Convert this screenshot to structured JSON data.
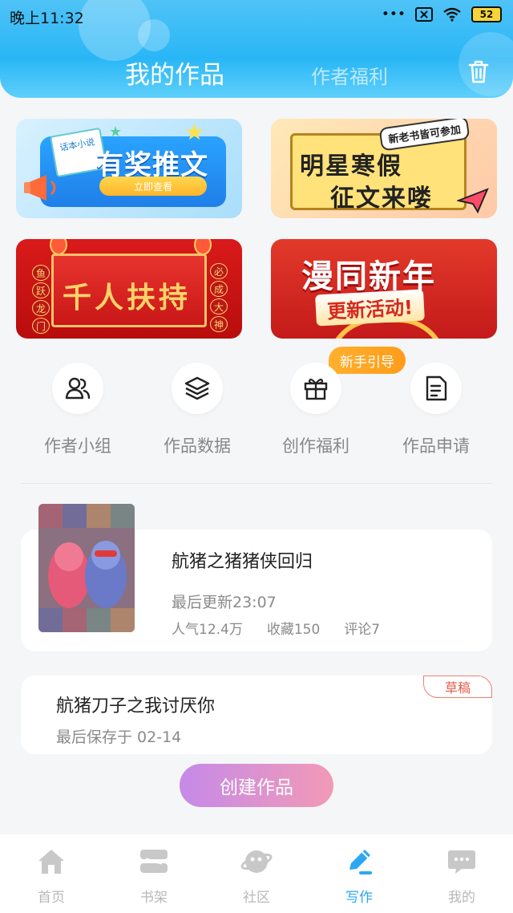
{
  "status_bar": {
    "time": "晚上11:32",
    "icons": [
      "more-dots-icon",
      "sim-off-icon",
      "wifi-icon",
      "battery-icon"
    ],
    "signal_dots": "•••",
    "battery_level": "52"
  },
  "header": {
    "tabs": [
      {
        "label": "我的作品",
        "active": true
      },
      {
        "label": "作者福利",
        "active": false
      }
    ],
    "trash_icon": "trash-icon",
    "accent": "#29b6f6"
  },
  "banners": [
    {
      "title": "有奖推文",
      "note": "话本小说",
      "button": "立即查看"
    },
    {
      "tag": "新老书皆可参加",
      "line1": "明星寒假",
      "line2": "征文来喽"
    },
    {
      "title": "千人扶持",
      "left_chars": [
        "鱼",
        "跃",
        "龙",
        "门"
      ],
      "right_chars": [
        "必",
        "成",
        "大",
        "神"
      ]
    },
    {
      "title": "漫同新年",
      "subtitle": "更新活动!"
    }
  ],
  "guide_badge": "新手引导",
  "quick_entries": [
    {
      "label": "作者小组",
      "icon": "author-group-icon"
    },
    {
      "label": "作品数据",
      "icon": "layers-icon"
    },
    {
      "label": "创作福利",
      "icon": "gift-icon"
    },
    {
      "label": "作品申请",
      "icon": "document-icon"
    }
  ],
  "works": [
    {
      "title": "航猪之猪猪侠回归",
      "updated": "最后更新23:07",
      "stats": [
        "人气12.4万",
        "收藏150",
        "评论7"
      ]
    }
  ],
  "drafts": [
    {
      "badge": "草稿",
      "title": "航猪刀子之我讨厌你",
      "saved": "最后保存于 02-14"
    }
  ],
  "create_button": "创建作品",
  "bottom_nav": [
    {
      "label": "首页",
      "icon": "home-icon",
      "active": false
    },
    {
      "label": "书架",
      "icon": "bookshelf-icon",
      "active": false
    },
    {
      "label": "社区",
      "icon": "community-icon",
      "active": false
    },
    {
      "label": "写作",
      "icon": "pen-icon",
      "active": true
    },
    {
      "label": "我的",
      "icon": "profile-icon",
      "active": false
    }
  ],
  "colors": {
    "nav_active": "#2aa8f2",
    "nav_inactive": "#c8c8c8",
    "create_start": "#c58ae8",
    "create_end": "#f29ab6",
    "draft_badge": "#e85a48"
  }
}
